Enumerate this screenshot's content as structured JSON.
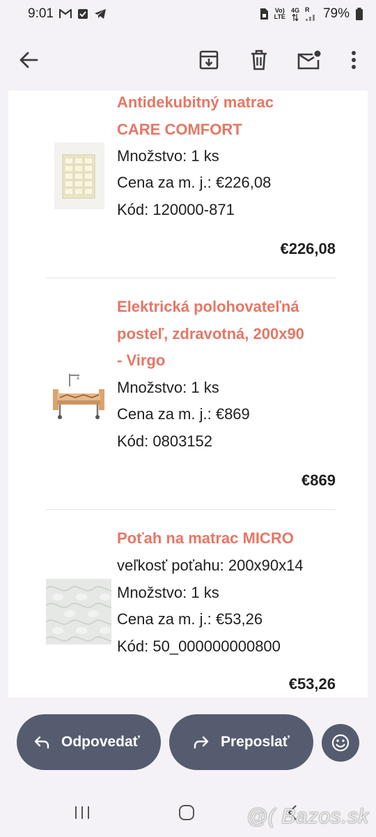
{
  "status": {
    "time": "9:01",
    "battery": "79%",
    "net_top": "Vo)",
    "net_bottom": "LTE",
    "net_gen": "4G",
    "net_r": "R"
  },
  "toolbar": {
    "back_icon": "arrow-left-icon",
    "archive_icon": "archive-icon",
    "delete_icon": "trash-icon",
    "unread_icon": "mark-unread-icon",
    "more_icon": "more-vert-icon"
  },
  "items": [
    {
      "name_lines": [
        "Antidekubitný matrac",
        "CARE COMFORT"
      ],
      "details": [
        "Množstvo: 1 ks",
        "Cena za m. j.: €226,08",
        "Kód: 120000-871"
      ],
      "total": "€226,08"
    },
    {
      "name_lines": [
        "Elektrická polohovateľná",
        "posteľ, zdravotná, 200x90",
        "- Virgo"
      ],
      "details": [
        "Množstvo: 1 ks",
        "Cena za m. j.: €869",
        "Kód: 0803152"
      ],
      "total": "€869"
    },
    {
      "name_lines": [
        "Poťah na matrac MICRO"
      ],
      "details": [
        "veľkosť poťahu: 200x90x14",
        "Množstvo: 1 ks",
        "Cena za m. j.: €53,26",
        "Kód: 50_000000000800"
      ],
      "total": "€53,26"
    }
  ],
  "actions": {
    "reply_label": "Odpovedať",
    "forward_label": "Preposlať",
    "emoji_icon": "smiley-icon"
  },
  "watermark": "@( Bazos.sk",
  "colors": {
    "accent": "#e57765",
    "pill": "#555c70",
    "background": "#f4f2f6"
  }
}
